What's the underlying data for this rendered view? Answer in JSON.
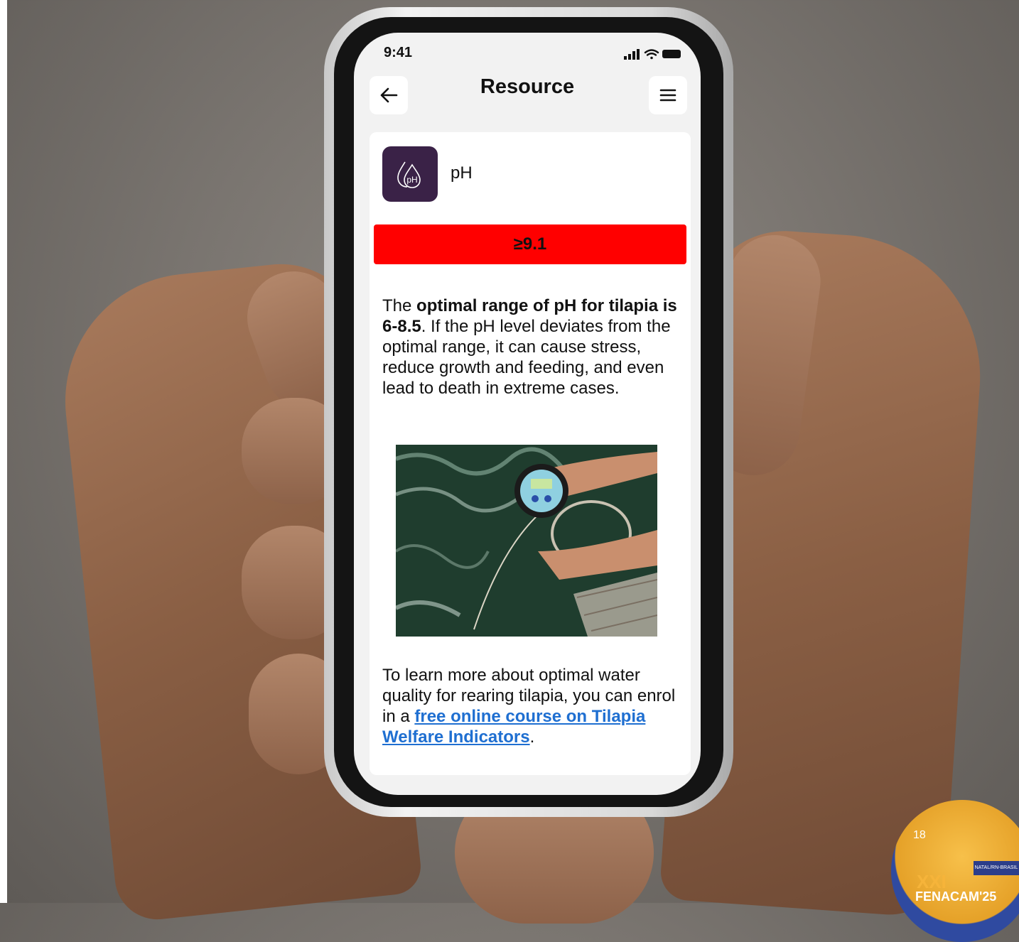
{
  "status": {
    "time": "9:41"
  },
  "nav": {
    "title": "Resource",
    "back_icon": "arrow-left-icon",
    "menu_icon": "hamburger-menu-icon"
  },
  "card": {
    "icon": "ph-drop-icon",
    "icon_text": "pH",
    "label": "pH",
    "range": "≥9.1",
    "range_color": "#ff0000",
    "desc": {
      "p1": "The ",
      "b1": "optimal range of pH for tilapia is 6-8.5",
      "p2": ". If the pH level deviates from the optimal range, it can cause stress, reduce growth and feeding, and even lead to death in extreme cases."
    },
    "more": {
      "p1": "To learn more about optimal water quality for rearing tilapia, you can enrol in a ",
      "link": "free online course on Tilapia Welfare Indicators",
      "p2": "."
    }
  },
  "slide_number": "18",
  "badge": {
    "strip": "NATAL/RN-BRASIL",
    "line1": "XXI",
    "line2": "FENACAM'25"
  },
  "colors": {
    "accent": "#3a2247",
    "link": "#1f6fd1"
  }
}
